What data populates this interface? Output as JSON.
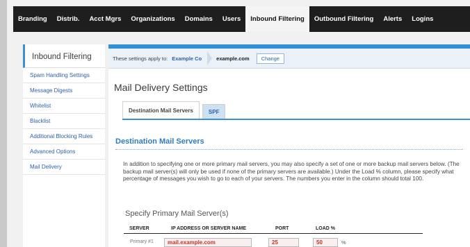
{
  "topnav": {
    "items": [
      {
        "label": "Branding"
      },
      {
        "label": "Distrib."
      },
      {
        "label": "Acct Mgrs"
      },
      {
        "label": "Organizations"
      },
      {
        "label": "Domains"
      },
      {
        "label": "Users"
      },
      {
        "label": "Inbound Filtering",
        "active": true
      },
      {
        "label": "Outbound Filtering"
      },
      {
        "label": "Alerts"
      },
      {
        "label": "Logins"
      }
    ]
  },
  "sidebar": {
    "title": "Inbound Filtering",
    "items": [
      {
        "label": "Spam Handling Settings"
      },
      {
        "label": "Message Digests"
      },
      {
        "label": "Whitelist"
      },
      {
        "label": "Blacklist"
      },
      {
        "label": "Additional Blocking Rules"
      },
      {
        "label": "Advanced Options"
      },
      {
        "label": "Mail Delivery"
      }
    ]
  },
  "applybar": {
    "prefix": "These settings apply to:",
    "org": "Example Co",
    "domain": "example.com",
    "change_label": "Change"
  },
  "main": {
    "title": "Mail Delivery Settings",
    "tabs": [
      {
        "label": "Destination Mail Servers",
        "active": true
      },
      {
        "label": "SPF"
      }
    ],
    "section_title": "Destination Mail Servers",
    "description": "In addition to specifying one or more primary mail servers, you may also specify a set of one or more backup mail servers below. (The backup mail server(s) will only be used if none of the primary servers are available.) Under the Load % column, please specify what percentage of messages you wish to go to each of your servers. The numbers you enter in the column should total 100.",
    "primary_title": "Specify Primary Mail Server(s)",
    "table": {
      "headers": [
        "SERVER",
        "IP ADDRESS OR SERVER NAME",
        "PORT",
        "LOAD %"
      ],
      "rows": [
        {
          "label": "Primary #1",
          "address": "mail.example.com",
          "port": "25",
          "load": "50",
          "unit": "%"
        }
      ]
    }
  },
  "colors": {
    "accent": "#2f8fd8",
    "nav_bg": "#1e1e1e",
    "field_text": "#c0392b"
  }
}
